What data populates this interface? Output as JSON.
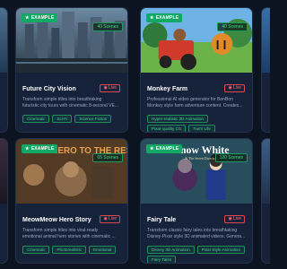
{
  "cards": [
    {
      "badge": "EXAMPLE",
      "scenes": "40 Scenes",
      "title": "Future City Vision",
      "live": "Live",
      "desc": [
        "Transform simple titles into breathtaking",
        "futuristic city tours with cinematic 8-second VE..."
      ],
      "tags": [
        "Cinematic",
        "Sci-Fi",
        "Science Fiction"
      ]
    },
    {
      "badge": "EXAMPLE",
      "scenes": "40 Scenes",
      "title": "Monkey Farm",
      "live": "Live",
      "desc": [
        "Professional AI video generator for BonBon",
        "Monkey style farm adventure content. Creates..."
      ],
      "tags": [
        "Hyper-realistic 3D Animation",
        "Pixar-quality CG",
        "Farm Life"
      ]
    },
    {
      "badge": "EXAMPLE",
      "scenes": "65 Scenes",
      "title": "MeowMeow Hero Story",
      "live": "Live",
      "desc": [
        "Transform simple titles into viral-ready",
        "emotional animal hero stories with cinematic ..."
      ],
      "tags": [
        "Cinematic",
        "Photorealistic",
        "Emotional"
      ]
    },
    {
      "badge": "EXAMPLE",
      "scenes": "120 Scenes",
      "title": "Fairy Tale",
      "live": "Live",
      "desc": [
        "Transform classic fairy tales into breathtaking",
        "Disney-Pixar style 3D animated videos. Genera..."
      ],
      "tags": [
        "Disney 3D Animation",
        "Pixar Style Animation",
        "Fairy Tales"
      ]
    }
  ],
  "thumb_text": {
    "hero": "HERO TO THE RES",
    "snow_white": "Snow White",
    "snow_white_sub": "& The Seven Dwarfs"
  },
  "icons": {
    "example": "star-icon",
    "live": "live-dot-icon"
  },
  "colors": {
    "background": "#0c1422",
    "card": "#16213a",
    "accent_green": "#13a866",
    "live_red": "#e0474f"
  }
}
